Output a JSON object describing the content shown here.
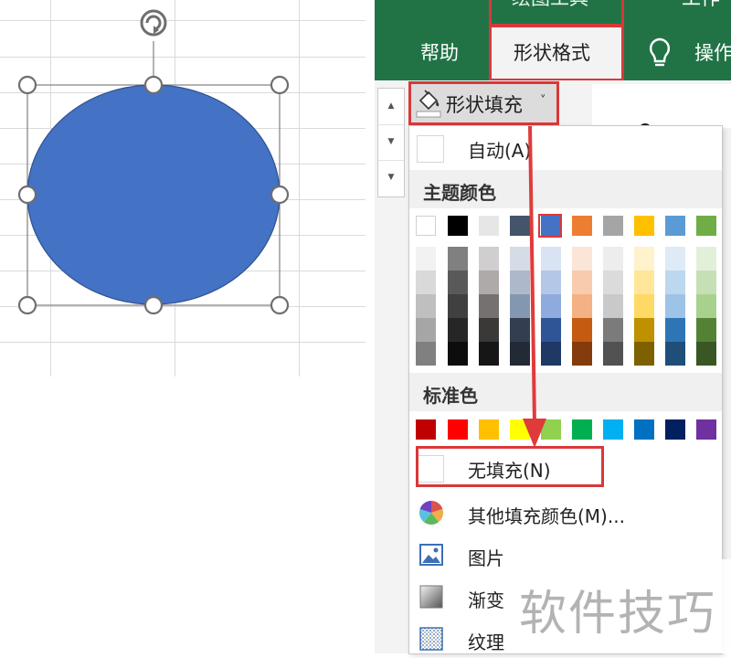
{
  "ribbon": {
    "tabs": [
      {
        "label": "绘图工具"
      },
      {
        "label": "工作"
      },
      {
        "label": "帮助"
      },
      {
        "label": "形状格式"
      },
      {
        "label": "操作"
      }
    ],
    "fill_button_label": "形状填充",
    "caret": "˅",
    "scroll_up": "▲",
    "scroll_down": "▼",
    "scroll_more": "▼"
  },
  "menu": {
    "auto_label": "自动(A)",
    "theme_colors_heading": "主题颜色",
    "standard_colors_heading": "标准色",
    "no_fill_label": "无填充(N)",
    "more_colors_label": "其他填充颜色(M)...",
    "picture_label": "图片",
    "gradient_label": "渐变",
    "texture_label": "纹理",
    "theme_colors": [
      "#ffffff",
      "#000000",
      "#e7e6e6",
      "#44546a",
      "#4472c4",
      "#ed7d31",
      "#a5a5a5",
      "#ffc000",
      "#5b9bd5",
      "#70ad47"
    ],
    "theme_shades": [
      [
        "#f2f2f2",
        "#d9d9d9",
        "#bfbfbf",
        "#a6a6a6",
        "#808080"
      ],
      [
        "#808080",
        "#595959",
        "#404040",
        "#262626",
        "#0d0d0d"
      ],
      [
        "#d0cece",
        "#aeaaaa",
        "#767171",
        "#3b3838",
        "#171616"
      ],
      [
        "#d6dce5",
        "#adb9ca",
        "#8497b0",
        "#333f50",
        "#222a35"
      ],
      [
        "#dae3f3",
        "#b4c7e7",
        "#8faadc",
        "#2f5597",
        "#1f3864"
      ],
      [
        "#fbe5d6",
        "#f8cbad",
        "#f4b183",
        "#c55a11",
        "#843c0c"
      ],
      [
        "#ededed",
        "#dbdbdb",
        "#c9c9c9",
        "#7b7b7b",
        "#525252"
      ],
      [
        "#fff2cc",
        "#ffe699",
        "#ffd966",
        "#bf9000",
        "#7f6000"
      ],
      [
        "#deebf7",
        "#bdd7ee",
        "#9dc3e6",
        "#2e75b6",
        "#1f4e79"
      ],
      [
        "#e2f0d9",
        "#c5e0b4",
        "#a9d18e",
        "#548235",
        "#385723"
      ]
    ],
    "standard_colors": [
      "#c00000",
      "#ff0000",
      "#ffc000",
      "#ffff00",
      "#92d050",
      "#00b050",
      "#00b0f0",
      "#0070c0",
      "#002060",
      "#7030a0"
    ]
  },
  "shape": {
    "fill": "#4472c4"
  },
  "watermark": "软件技巧"
}
